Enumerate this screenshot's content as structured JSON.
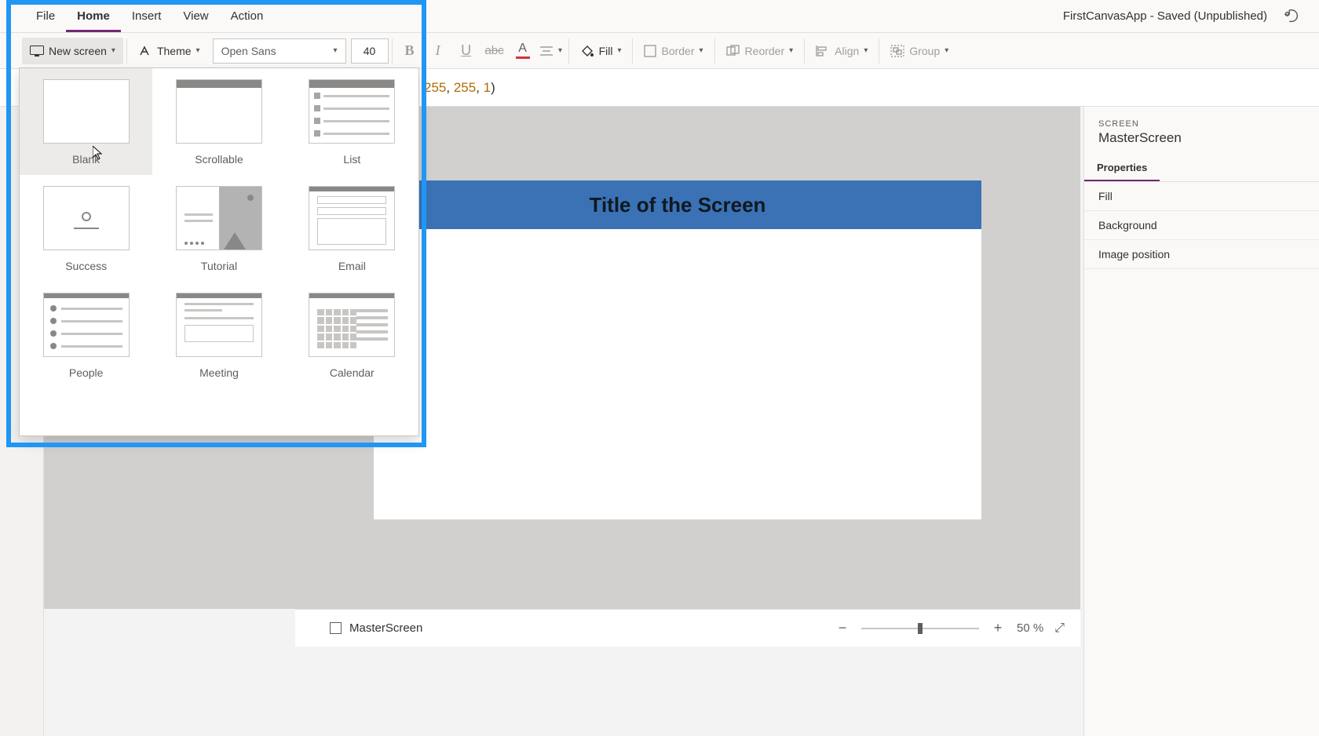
{
  "title_bar": {
    "menus": [
      "File",
      "Home",
      "Insert",
      "View",
      "Action"
    ],
    "active_menu": "Home",
    "doc_title": "FirstCanvasApp - Saved (Unpublished)"
  },
  "toolbar": {
    "new_screen": "New screen",
    "theme": "Theme",
    "font_name": "Open Sans",
    "font_size": "40",
    "fill": "Fill",
    "border": "Border",
    "reorder": "Reorder",
    "align": "Align",
    "group": "Group"
  },
  "formula": {
    "v1": "255",
    "v2": "255",
    "v3": "1"
  },
  "dropdown": {
    "templates": [
      {
        "key": "blank",
        "label": "Blank"
      },
      {
        "key": "scrollable",
        "label": "Scrollable"
      },
      {
        "key": "list",
        "label": "List"
      },
      {
        "key": "success",
        "label": "Success"
      },
      {
        "key": "tutorial",
        "label": "Tutorial"
      },
      {
        "key": "email",
        "label": "Email"
      },
      {
        "key": "people",
        "label": "People"
      },
      {
        "key": "meeting",
        "label": "Meeting"
      },
      {
        "key": "calendar",
        "label": "Calendar"
      }
    ]
  },
  "canvas": {
    "header_text": "Title of the Screen"
  },
  "properties": {
    "type_label": "SCREEN",
    "name": "MasterScreen",
    "tab": "Properties",
    "rows": [
      "Fill",
      "Background",
      "Image position"
    ]
  },
  "status_bar": {
    "screen_label": "MasterScreen",
    "zoom_minus": "−",
    "zoom_plus": "+",
    "zoom_value": "50",
    "zoom_pct": " %"
  }
}
